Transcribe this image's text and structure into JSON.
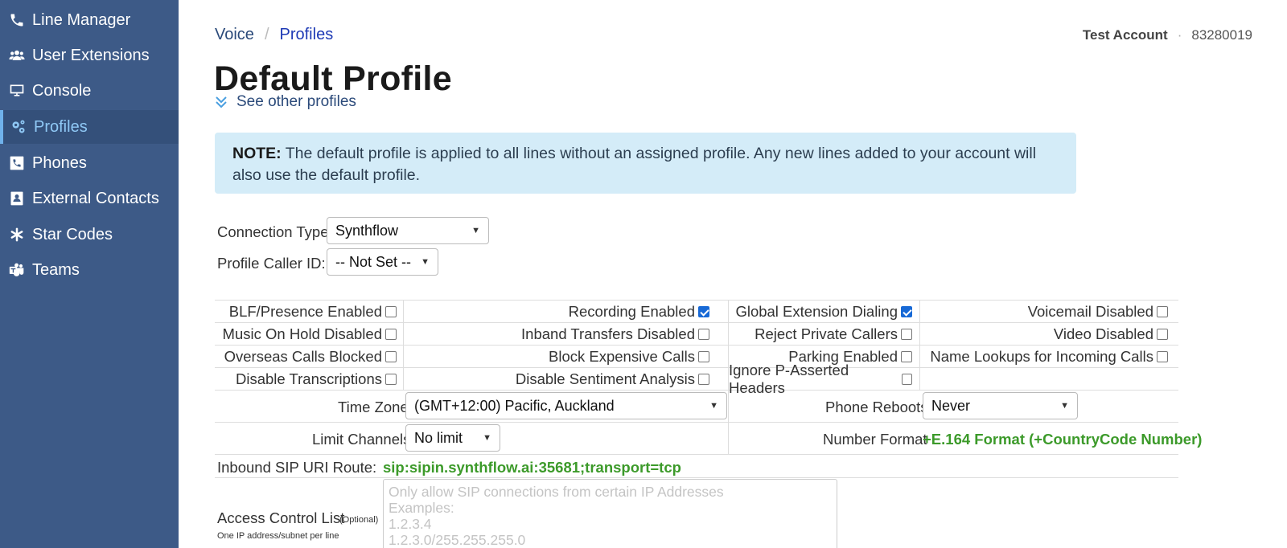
{
  "sidebar": {
    "items": [
      {
        "label": "Line Manager",
        "icon": "phone-icon"
      },
      {
        "label": "User Extensions",
        "icon": "users-icon"
      },
      {
        "label": "Console",
        "icon": "monitor-icon"
      },
      {
        "label": "Profiles",
        "icon": "cogs-icon",
        "active": true
      },
      {
        "label": "Phones",
        "icon": "phone-square-icon"
      },
      {
        "label": "External Contacts",
        "icon": "address-book-icon"
      },
      {
        "label": "Star Codes",
        "icon": "asterisk-icon"
      },
      {
        "label": "Teams",
        "icon": "teams-icon"
      }
    ]
  },
  "breadcrumb": {
    "root": "Voice",
    "separator": "/",
    "current": "Profiles"
  },
  "account": {
    "name": "Test Account",
    "dot": "·",
    "id": "83280019"
  },
  "page": {
    "title": "Default Profile",
    "other_profiles_link": "See other profiles"
  },
  "note": {
    "label": "NOTE:",
    "text": "The default profile is applied to all lines without an assigned profile. Any new lines added to your account will also use the default profile."
  },
  "form": {
    "connection_type_label": "Connection Type:",
    "connection_type_value": "Synthflow",
    "caller_id_label": "Profile Caller ID:",
    "caller_id_value": "-- Not Set --"
  },
  "options": {
    "col1": [
      {
        "label": "BLF/Presence Enabled",
        "checked": false
      },
      {
        "label": "Music On Hold Disabled",
        "checked": false
      },
      {
        "label": "Overseas Calls Blocked",
        "checked": false
      },
      {
        "label": "Disable Transcriptions",
        "checked": false
      }
    ],
    "col2": [
      {
        "label": "Recording Enabled",
        "checked": true
      },
      {
        "label": "Inband Transfers Disabled",
        "checked": false
      },
      {
        "label": "Block Expensive Calls",
        "checked": false
      },
      {
        "label": "Disable Sentiment Analysis",
        "checked": false
      }
    ],
    "col3": [
      {
        "label": "Global Extension Dialing",
        "checked": true
      },
      {
        "label": "Reject Private Callers",
        "checked": false
      },
      {
        "label": "Parking Enabled",
        "checked": false
      },
      {
        "label": "Ignore P-Asserted Headers",
        "checked": false
      }
    ],
    "col4": [
      {
        "label": "Voicemail Disabled",
        "checked": false
      },
      {
        "label": "Video Disabled",
        "checked": false
      },
      {
        "label": "Name Lookups for Incoming Calls",
        "checked": false
      }
    ]
  },
  "settings": {
    "time_zone_label": "Time Zone",
    "time_zone_value": "(GMT+12:00) Pacific, Auckland",
    "phone_reboots_label": "Phone Reboots",
    "phone_reboots_value": "Never",
    "limit_channels_label": "Limit Channels",
    "limit_channels_value": "No limit",
    "number_format_label": "Number Format",
    "number_format_value": "+E.164 Format (+CountryCode Number)",
    "sip_route_label": "Inbound SIP URI Route:",
    "sip_route_value": "sip:sipin.synthflow.ai:35681;transport=tcp",
    "acl_label": "Access Control List",
    "acl_optional": "(Optional)",
    "acl_hint": "One IP address/subnet per line",
    "acl_placeholder": "Only allow SIP connections from certain IP Addresses\nExamples:\n1.2.3.4\n1.2.3.0/255.255.255.0"
  },
  "colors": {
    "sidebar_bg": "#3d5a87",
    "accent": "#1d39b5",
    "note_bg": "#d4ecf8",
    "green": "#3c9a2a",
    "checkbox_checked": "#1769d6"
  }
}
